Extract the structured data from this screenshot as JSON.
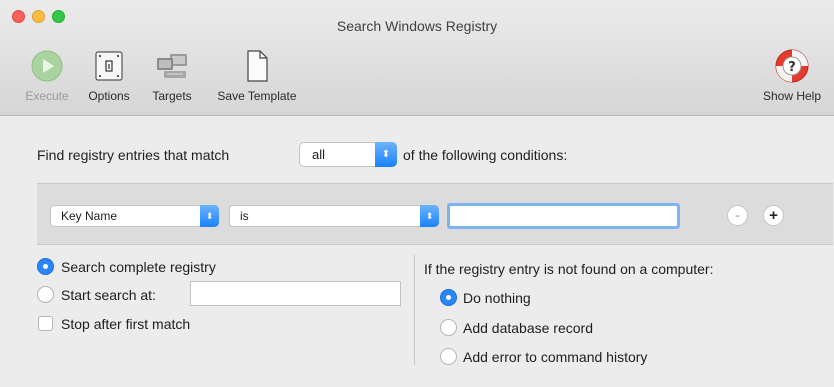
{
  "window": {
    "title": "Search Windows Registry"
  },
  "toolbar": {
    "items": [
      {
        "label": "Execute",
        "icon": "play-icon",
        "enabled": false
      },
      {
        "label": "Options",
        "icon": "options-icon",
        "enabled": true
      },
      {
        "label": "Targets",
        "icon": "targets-icon",
        "enabled": true
      },
      {
        "label": "Save Template",
        "icon": "document-icon",
        "enabled": true
      }
    ],
    "help": {
      "label": "Show Help",
      "icon": "help-lifebuoy-icon"
    }
  },
  "match": {
    "prefix": "Find registry entries that match",
    "selected": "all",
    "suffix": "of the following conditions:"
  },
  "condition": {
    "field": "Key Name",
    "operator": "is",
    "value": "",
    "remove_label": "-",
    "add_label": "+"
  },
  "scope": {
    "complete_label": "Search complete registry",
    "start_label": "Start search at:",
    "start_value": "",
    "stop_label": "Stop after first match",
    "selected": "complete",
    "stop_checked": false
  },
  "not_found": {
    "heading": "If the registry entry is not found on a computer:",
    "options": [
      "Do nothing",
      "Add database record",
      "Add error to command history"
    ],
    "selected_index": 0
  },
  "colors": {
    "accent": "#2d86f9",
    "focus_ring": "#7fb3ef"
  }
}
